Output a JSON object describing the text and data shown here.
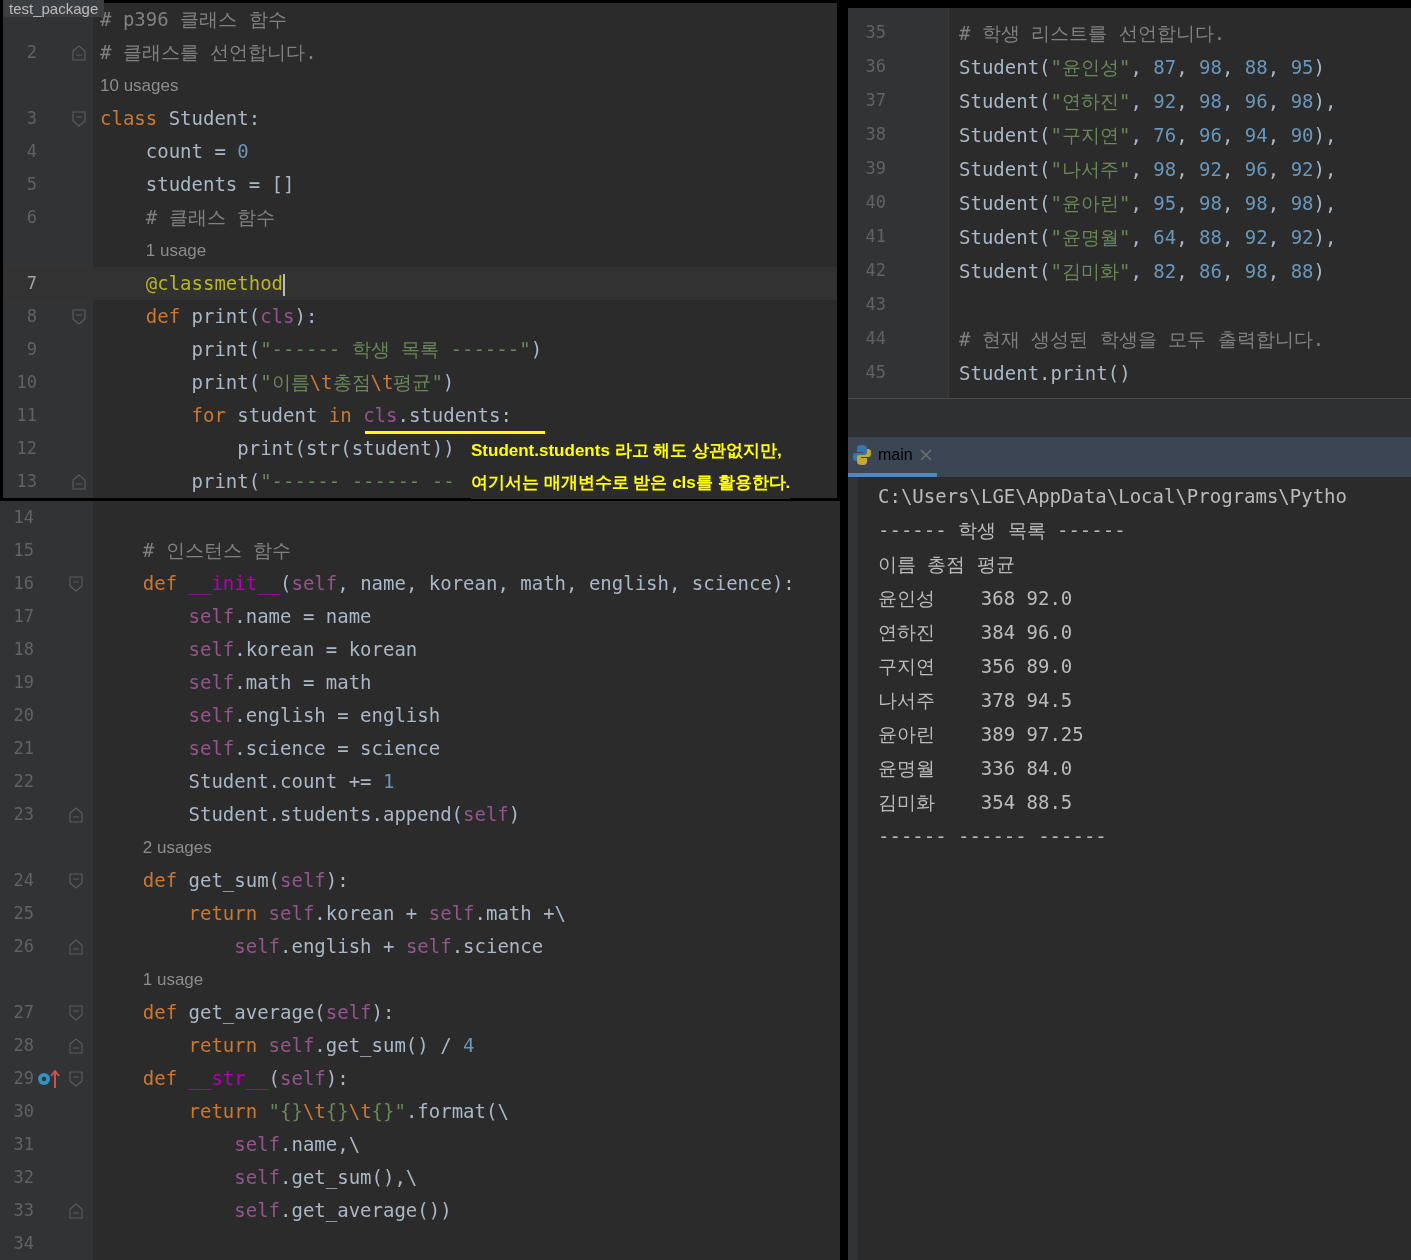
{
  "editor_left": {
    "tab_label": "test_package",
    "framed_rows": [
      {
        "tokens": [
          {
            "kind": "com",
            "text": "# p396 클래스 함수"
          }
        ]
      },
      {
        "number": "2",
        "fold": {
          "kind": "end"
        },
        "tokens": [
          {
            "kind": "com",
            "text": "# 클래스를 선언합니다."
          }
        ]
      },
      {
        "usage": "10 usages"
      },
      {
        "number": "3",
        "fold": {
          "kind": "start"
        },
        "tokens": [
          {
            "kind": "kw",
            "text": "class "
          },
          {
            "kind": "p",
            "text": "Student:"
          }
        ]
      },
      {
        "number": "4",
        "tokens": [
          {
            "kind": "p",
            "text": "    count = "
          },
          {
            "kind": "num",
            "text": "0"
          }
        ]
      },
      {
        "number": "5",
        "tokens": [
          {
            "kind": "p",
            "text": "    students = []"
          }
        ]
      },
      {
        "number": "6",
        "tokens": [
          {
            "kind": "com",
            "text": "    # 클래스 함수"
          }
        ]
      },
      {
        "usage": "1 usage"
      },
      {
        "number": "7",
        "current": true,
        "tokens": [
          {
            "kind": "deco",
            "text": "    @classmethod"
          }
        ]
      },
      {
        "number": "8",
        "fold": {
          "kind": "start"
        },
        "tokens": [
          {
            "kind": "kw",
            "text": "    def "
          },
          {
            "kind": "p",
            "text": "print("
          },
          {
            "kind": "self",
            "text": "cls"
          },
          {
            "kind": "p",
            "text": "):"
          }
        ]
      },
      {
        "number": "9",
        "tokens": [
          {
            "kind": "p",
            "text": "        print("
          },
          {
            "kind": "str",
            "text": "\"------ 학생 목록 ------\""
          },
          {
            "kind": "p",
            "text": ")"
          }
        ]
      },
      {
        "number": "10",
        "tokens": [
          {
            "kind": "p",
            "text": "        print("
          },
          {
            "kind": "str",
            "text": "\"이름"
          },
          {
            "kind": "esc",
            "text": "\\t"
          },
          {
            "kind": "str",
            "text": "총점"
          },
          {
            "kind": "esc",
            "text": "\\t"
          },
          {
            "kind": "str",
            "text": "평균\""
          },
          {
            "kind": "p",
            "text": ")"
          }
        ]
      },
      {
        "number": "11",
        "tokens": [
          {
            "kind": "kw",
            "text": "        for "
          },
          {
            "kind": "p",
            "text": "student "
          },
          {
            "kind": "kw",
            "text": "in "
          },
          {
            "kind": "self",
            "text": "cls"
          },
          {
            "kind": "p",
            "text": ".students:"
          }
        ]
      },
      {
        "number": "12",
        "tokens": [
          {
            "kind": "p",
            "text": "            print(str(student))"
          }
        ]
      },
      {
        "number": "13",
        "fold": {
          "kind": "end"
        },
        "tokens": [
          {
            "kind": "p",
            "text": "        print("
          },
          {
            "kind": "str",
            "text": "\"------ ------ --"
          }
        ]
      }
    ],
    "annotation": [
      "Student.students 라고 해도 상관없지만,",
      "여기서는 매개변수로 받은 cls를 활용한다."
    ],
    "rows": [
      {
        "number": "14",
        "tokens": []
      },
      {
        "number": "15",
        "tokens": [
          {
            "kind": "com",
            "text": "    # 인스턴스 함수"
          }
        ]
      },
      {
        "number": "16",
        "fold": {
          "kind": "start"
        },
        "tokens": [
          {
            "kind": "kw",
            "text": "    def "
          },
          {
            "kind": "magic",
            "text": "__init__"
          },
          {
            "kind": "p",
            "text": "("
          },
          {
            "kind": "self",
            "text": "self"
          },
          {
            "kind": "p",
            "text": ", name, korean, math, english, science):"
          }
        ]
      },
      {
        "number": "17",
        "tokens": [
          {
            "kind": "self",
            "text": "        self"
          },
          {
            "kind": "p",
            "text": ".name = name"
          }
        ]
      },
      {
        "number": "18",
        "tokens": [
          {
            "kind": "self",
            "text": "        self"
          },
          {
            "kind": "p",
            "text": ".korean = korean"
          }
        ]
      },
      {
        "number": "19",
        "tokens": [
          {
            "kind": "self",
            "text": "        self"
          },
          {
            "kind": "p",
            "text": ".math = math"
          }
        ]
      },
      {
        "number": "20",
        "tokens": [
          {
            "kind": "self",
            "text": "        self"
          },
          {
            "kind": "p",
            "text": ".english = english"
          }
        ]
      },
      {
        "number": "21",
        "tokens": [
          {
            "kind": "self",
            "text": "        self"
          },
          {
            "kind": "p",
            "text": ".science = science"
          }
        ]
      },
      {
        "number": "22",
        "tokens": [
          {
            "kind": "p",
            "text": "        Student.count += "
          },
          {
            "kind": "num",
            "text": "1"
          }
        ]
      },
      {
        "number": "23",
        "fold": {
          "kind": "end"
        },
        "tokens": [
          {
            "kind": "p",
            "text": "        Student.students.append("
          },
          {
            "kind": "self",
            "text": "self"
          },
          {
            "kind": "p",
            "text": ")"
          }
        ]
      },
      {
        "usage": "2 usages"
      },
      {
        "number": "24",
        "fold": {
          "kind": "start"
        },
        "tokens": [
          {
            "kind": "kw",
            "text": "    def "
          },
          {
            "kind": "p",
            "text": "get_sum("
          },
          {
            "kind": "self",
            "text": "self"
          },
          {
            "kind": "p",
            "text": "):"
          }
        ]
      },
      {
        "number": "25",
        "tokens": [
          {
            "kind": "kw",
            "text": "        return "
          },
          {
            "kind": "self",
            "text": "self"
          },
          {
            "kind": "p",
            "text": ".korean + "
          },
          {
            "kind": "self",
            "text": "self"
          },
          {
            "kind": "p",
            "text": ".math +\\"
          }
        ]
      },
      {
        "number": "26",
        "fold": {
          "kind": "end"
        },
        "tokens": [
          {
            "kind": "self",
            "text": "            self"
          },
          {
            "kind": "p",
            "text": ".english + "
          },
          {
            "kind": "self",
            "text": "self"
          },
          {
            "kind": "p",
            "text": ".science"
          }
        ]
      },
      {
        "usage": "1 usage"
      },
      {
        "number": "27",
        "fold": {
          "kind": "start"
        },
        "tokens": [
          {
            "kind": "kw",
            "text": "    def "
          },
          {
            "kind": "p",
            "text": "get_average("
          },
          {
            "kind": "self",
            "text": "self"
          },
          {
            "kind": "p",
            "text": "):"
          }
        ]
      },
      {
        "number": "28",
        "fold": {
          "kind": "end"
        },
        "tokens": [
          {
            "kind": "kw",
            "text": "        return "
          },
          {
            "kind": "self",
            "text": "self"
          },
          {
            "kind": "p",
            "text": ".get_sum() / "
          },
          {
            "kind": "num",
            "text": "4"
          }
        ]
      },
      {
        "number": "29",
        "fold": {
          "kind": "start"
        },
        "override": true,
        "tokens": [
          {
            "kind": "kw",
            "text": "    def "
          },
          {
            "kind": "magic",
            "text": "__str__"
          },
          {
            "kind": "p",
            "text": "("
          },
          {
            "kind": "self",
            "text": "self"
          },
          {
            "kind": "p",
            "text": "):"
          }
        ]
      },
      {
        "number": "30",
        "tokens": [
          {
            "kind": "kw",
            "text": "        return "
          },
          {
            "kind": "str",
            "text": "\"{}"
          },
          {
            "kind": "esc",
            "text": "\\t"
          },
          {
            "kind": "str",
            "text": "{}"
          },
          {
            "kind": "esc",
            "text": "\\t"
          },
          {
            "kind": "str",
            "text": "{}\""
          },
          {
            "kind": "p",
            "text": ".format(\\"
          }
        ]
      },
      {
        "number": "31",
        "tokens": [
          {
            "kind": "self",
            "text": "            self"
          },
          {
            "kind": "p",
            "text": ".name,\\"
          }
        ]
      },
      {
        "number": "32",
        "tokens": [
          {
            "kind": "self",
            "text": "            self"
          },
          {
            "kind": "p",
            "text": ".get_sum(),\\"
          }
        ]
      },
      {
        "number": "33",
        "fold": {
          "kind": "end"
        },
        "tokens": [
          {
            "kind": "self",
            "text": "            self"
          },
          {
            "kind": "p",
            "text": ".get_average())"
          }
        ]
      },
      {
        "number": "34",
        "tokens": []
      }
    ]
  },
  "editor_right": {
    "rows": [
      {
        "number": "35",
        "tokens": [
          {
            "kind": "com",
            "text": "# 학생 리스트를 선언합니다."
          }
        ]
      },
      {
        "number": "36",
        "tokens": [
          {
            "kind": "p",
            "text": "Student("
          },
          {
            "kind": "str",
            "text": "\"윤인성\""
          },
          {
            "kind": "p",
            "text": ", "
          },
          {
            "kind": "num",
            "text": "87"
          },
          {
            "kind": "p",
            "text": ", "
          },
          {
            "kind": "num",
            "text": "98"
          },
          {
            "kind": "p",
            "text": ", "
          },
          {
            "kind": "num",
            "text": "88"
          },
          {
            "kind": "p",
            "text": ", "
          },
          {
            "kind": "num",
            "text": "95"
          },
          {
            "kind": "p",
            "text": ")"
          }
        ]
      },
      {
        "number": "37",
        "tokens": [
          {
            "kind": "p",
            "text": "Student("
          },
          {
            "kind": "str",
            "text": "\"연하진\""
          },
          {
            "kind": "p",
            "text": ", "
          },
          {
            "kind": "num",
            "text": "92"
          },
          {
            "kind": "p",
            "text": ", "
          },
          {
            "kind": "num",
            "text": "98"
          },
          {
            "kind": "p",
            "text": ", "
          },
          {
            "kind": "num",
            "text": "96"
          },
          {
            "kind": "p",
            "text": ", "
          },
          {
            "kind": "num",
            "text": "98"
          },
          {
            "kind": "p",
            "text": "),"
          }
        ]
      },
      {
        "number": "38",
        "tokens": [
          {
            "kind": "p",
            "text": "Student("
          },
          {
            "kind": "str",
            "text": "\"구지연\""
          },
          {
            "kind": "p",
            "text": ", "
          },
          {
            "kind": "num",
            "text": "76"
          },
          {
            "kind": "p",
            "text": ", "
          },
          {
            "kind": "num",
            "text": "96"
          },
          {
            "kind": "p",
            "text": ", "
          },
          {
            "kind": "num",
            "text": "94"
          },
          {
            "kind": "p",
            "text": ", "
          },
          {
            "kind": "num",
            "text": "90"
          },
          {
            "kind": "p",
            "text": "),"
          }
        ]
      },
      {
        "number": "39",
        "tokens": [
          {
            "kind": "p",
            "text": "Student("
          },
          {
            "kind": "str",
            "text": "\"나서주\""
          },
          {
            "kind": "p",
            "text": ", "
          },
          {
            "kind": "num",
            "text": "98"
          },
          {
            "kind": "p",
            "text": ", "
          },
          {
            "kind": "num",
            "text": "92"
          },
          {
            "kind": "p",
            "text": ", "
          },
          {
            "kind": "num",
            "text": "96"
          },
          {
            "kind": "p",
            "text": ", "
          },
          {
            "kind": "num",
            "text": "92"
          },
          {
            "kind": "p",
            "text": "),"
          }
        ]
      },
      {
        "number": "40",
        "tokens": [
          {
            "kind": "p",
            "text": "Student("
          },
          {
            "kind": "str",
            "text": "\"윤아린\""
          },
          {
            "kind": "p",
            "text": ", "
          },
          {
            "kind": "num",
            "text": "95"
          },
          {
            "kind": "p",
            "text": ", "
          },
          {
            "kind": "num",
            "text": "98"
          },
          {
            "kind": "p",
            "text": ", "
          },
          {
            "kind": "num",
            "text": "98"
          },
          {
            "kind": "p",
            "text": ", "
          },
          {
            "kind": "num",
            "text": "98"
          },
          {
            "kind": "p",
            "text": "),"
          }
        ]
      },
      {
        "number": "41",
        "tokens": [
          {
            "kind": "p",
            "text": "Student("
          },
          {
            "kind": "str",
            "text": "\"윤명월\""
          },
          {
            "kind": "p",
            "text": ", "
          },
          {
            "kind": "num",
            "text": "64"
          },
          {
            "kind": "p",
            "text": ", "
          },
          {
            "kind": "num",
            "text": "88"
          },
          {
            "kind": "p",
            "text": ", "
          },
          {
            "kind": "num",
            "text": "92"
          },
          {
            "kind": "p",
            "text": ", "
          },
          {
            "kind": "num",
            "text": "92"
          },
          {
            "kind": "p",
            "text": "),"
          }
        ]
      },
      {
        "number": "42",
        "tokens": [
          {
            "kind": "p",
            "text": "Student("
          },
          {
            "kind": "str",
            "text": "\"김미화\""
          },
          {
            "kind": "p",
            "text": ", "
          },
          {
            "kind": "num",
            "text": "82"
          },
          {
            "kind": "p",
            "text": ", "
          },
          {
            "kind": "num",
            "text": "86"
          },
          {
            "kind": "p",
            "text": ", "
          },
          {
            "kind": "num",
            "text": "98"
          },
          {
            "kind": "p",
            "text": ", "
          },
          {
            "kind": "num",
            "text": "88"
          },
          {
            "kind": "p",
            "text": ")"
          }
        ]
      },
      {
        "number": "43",
        "tokens": []
      },
      {
        "number": "44",
        "tokens": [
          {
            "kind": "com",
            "text": "# 현재 생성된 학생을 모두 출력합니다."
          }
        ]
      },
      {
        "number": "45",
        "tokens": [
          {
            "kind": "p",
            "text": "Student.print()"
          }
        ]
      }
    ]
  },
  "run_panel": {
    "tab": {
      "label": "main",
      "selected": true
    },
    "console": [
      "C:\\Users\\LGE\\AppData\\Local\\Programs\\Pytho",
      "------ 학생 목록 ------",
      "이름 총점 평균",
      "윤인성    368 92.0",
      "연하진    384 96.0",
      "구지연    356 89.0",
      "나서주    378 94.5",
      "윤아린    389 97.25",
      "윤명월    336 84.0",
      "김미화    354 88.5",
      "------ ------ ------"
    ]
  }
}
